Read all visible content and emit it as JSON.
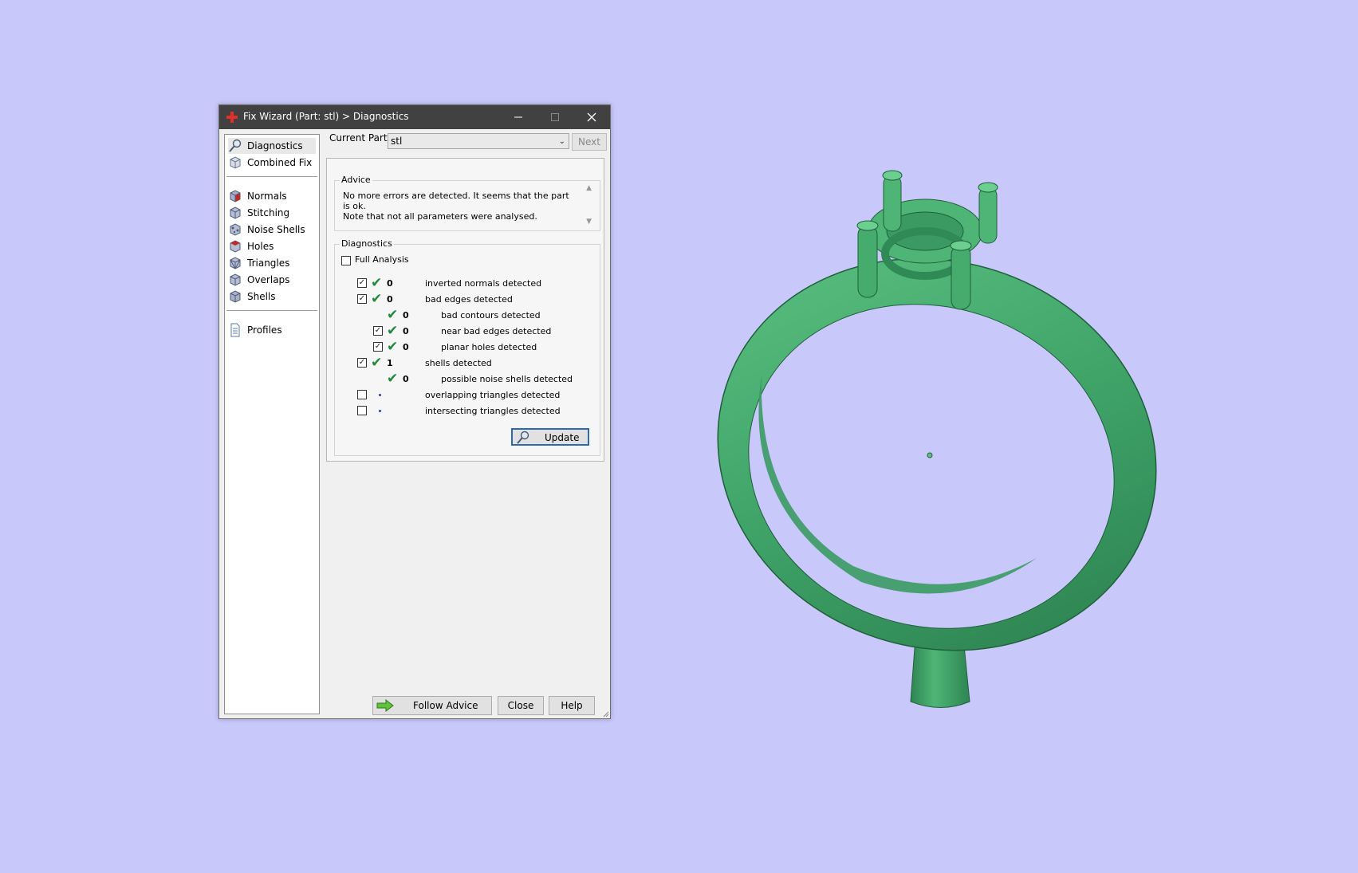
{
  "window": {
    "title": "Fix Wizard (Part: stl) > Diagnostics"
  },
  "nav": {
    "items": [
      {
        "label": "Diagnostics",
        "icon": "magnifier-icon",
        "selected": true
      },
      {
        "label": "Combined Fix",
        "icon": "cube-icon"
      },
      {
        "label": "Normals",
        "icon": "normals-cube-icon"
      },
      {
        "label": "Stitching",
        "icon": "stitching-cube-icon"
      },
      {
        "label": "Noise Shells",
        "icon": "noise-shells-icon"
      },
      {
        "label": "Holes",
        "icon": "holes-cube-icon"
      },
      {
        "label": "Triangles",
        "icon": "triangles-cube-icon"
      },
      {
        "label": "Overlaps",
        "icon": "overlaps-cube-icon"
      },
      {
        "label": "Shells",
        "icon": "shells-cube-icon"
      },
      {
        "label": "Profiles",
        "icon": "document-icon"
      }
    ]
  },
  "part": {
    "label": "Current Part:",
    "value": "stl",
    "next": "Next"
  },
  "advice": {
    "legend": "Advice",
    "text": "No more errors are detected. It seems that the part is ok.\nNote that not all parameters were analysed."
  },
  "diagnostics": {
    "legend": "Diagnostics",
    "full_analysis": "Full Analysis",
    "rows": [
      {
        "checked": true,
        "status": "ok",
        "count": "0",
        "label": "inverted normals detected",
        "indent": 0
      },
      {
        "checked": true,
        "status": "ok",
        "count": "0",
        "label": "bad edges detected",
        "indent": 0
      },
      {
        "checked": null,
        "status": "ok",
        "count": "0",
        "label": "bad contours detected",
        "indent": 1
      },
      {
        "checked": true,
        "status": "ok",
        "count": "0",
        "label": "near bad edges detected",
        "indent": 1
      },
      {
        "checked": true,
        "status": "ok",
        "count": "0",
        "label": "planar holes detected",
        "indent": 1
      },
      {
        "checked": true,
        "status": "ok",
        "count": "1",
        "label": "shells detected",
        "indent": 0
      },
      {
        "checked": null,
        "status": "ok",
        "count": "0",
        "label": "possible noise shells detected",
        "indent": 1
      },
      {
        "checked": false,
        "status": "none",
        "count": "",
        "label": "overlapping triangles detected",
        "indent": 0
      },
      {
        "checked": false,
        "status": "none",
        "count": "",
        "label": "intersecting triangles detected",
        "indent": 0
      }
    ],
    "update": "Update"
  },
  "buttons": {
    "follow_advice": "Follow Advice",
    "close": "Close",
    "help": "Help"
  },
  "colors": {
    "background": "#c9c8fb",
    "model": "#3fa368",
    "ok": "#1f8a3a",
    "titlebar": "#414141"
  }
}
